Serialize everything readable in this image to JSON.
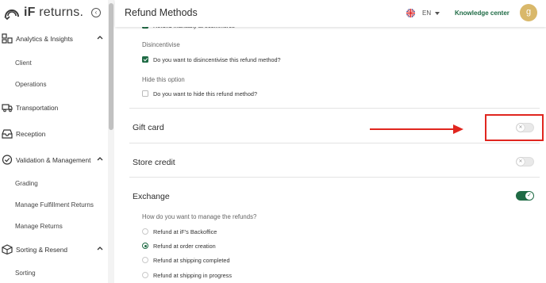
{
  "brand": {
    "logo_bold": "iF",
    "logo_light": "returns."
  },
  "sidebar": {
    "collapse_icon": "collapse-left-icon",
    "sections": [
      {
        "label": "Analytics & Insights",
        "icon": "analytics-icon",
        "expanded": true,
        "items": [
          "Client",
          "Operations"
        ]
      },
      {
        "label": "Transportation",
        "icon": "truck-icon",
        "expanded": false,
        "items": []
      },
      {
        "label": "Reception",
        "icon": "inbox-icon",
        "expanded": false,
        "items": []
      },
      {
        "label": "Validation & Management",
        "icon": "check-circle-icon",
        "expanded": true,
        "items": [
          "Grading",
          "Manage Fulfillment Returns",
          "Manage Returns"
        ]
      },
      {
        "label": "Sorting & Resend",
        "icon": "box-icon",
        "expanded": true,
        "items": [
          "Sorting"
        ]
      }
    ]
  },
  "header": {
    "title": "Refund Methods",
    "language": "EN",
    "knowledge_center": "Knowledge center",
    "avatar_letter": "g"
  },
  "content": {
    "top_option": {
      "label": "Refund manually at ecommerce",
      "checked": true
    },
    "disincentivise": {
      "heading": "Disincentivise",
      "label": "Do you want to disincentivise this refund method?",
      "checked": true
    },
    "hide": {
      "heading": "Hide this option",
      "label": "Do you want to hide this refund method?",
      "checked": false
    },
    "methods": [
      {
        "label": "Gift card",
        "enabled": false
      },
      {
        "label": "Store credit",
        "enabled": false
      },
      {
        "label": "Exchange",
        "enabled": true
      }
    ],
    "exchange": {
      "question": "How do you want to manage the refunds?",
      "options": [
        {
          "label": "Refund at iF's Backoffice",
          "selected": false
        },
        {
          "label": "Refund at order creation",
          "selected": true
        },
        {
          "label": "Refund at shipping completed",
          "selected": false
        },
        {
          "label": "Refund at shipping in progress",
          "selected": false
        }
      ]
    }
  },
  "colors": {
    "brand_green": "#1f6b45",
    "annotation_red": "#e0261f",
    "avatar": "#d9b86a"
  }
}
